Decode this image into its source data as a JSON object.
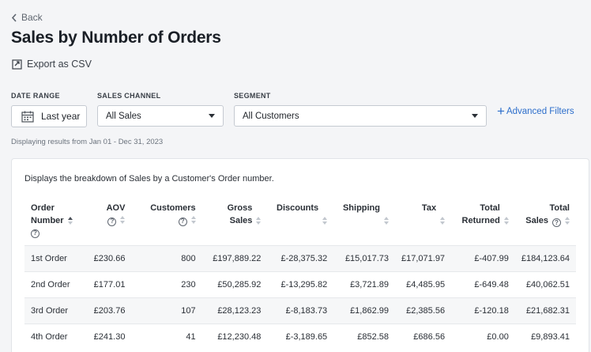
{
  "nav": {
    "back_label": "Back"
  },
  "page": {
    "title": "Sales by Number of Orders",
    "export_label": "Export as CSV"
  },
  "filters": {
    "date_range": {
      "label": "DATE RANGE",
      "value": "Last year"
    },
    "sales_channel": {
      "label": "SALES CHANNEL",
      "value": "All Sales"
    },
    "segment": {
      "label": "SEGMENT",
      "value": "All Customers"
    },
    "advanced_label": "Advanced Filters"
  },
  "range_text": "Displaying results from Jan 01 - Dec 31, 2023",
  "card": {
    "description": "Displays the breakdown of Sales by a Customer's Order number."
  },
  "table": {
    "headers": {
      "order_number": [
        "Order",
        "Number"
      ],
      "aov": "AOV",
      "customers": "Customers",
      "gross_sales": [
        "Gross",
        "Sales"
      ],
      "discounts": "Discounts",
      "shipping": "Shipping",
      "tax": "Tax",
      "total_returned": [
        "Total",
        "Returned"
      ],
      "total_sales": [
        "Total",
        "Sales"
      ]
    },
    "rows": [
      {
        "order": "1st Order",
        "aov": "£230.66",
        "customers": "800",
        "gross": "£197,889.22",
        "discounts": "£-28,375.32",
        "shipping": "£15,017.73",
        "tax": "£17,071.97",
        "returned": "£-407.99",
        "total": "£184,123.64"
      },
      {
        "order": "2nd Order",
        "aov": "£177.01",
        "customers": "230",
        "gross": "£50,285.92",
        "discounts": "£-13,295.82",
        "shipping": "£3,721.89",
        "tax": "£4,485.95",
        "returned": "£-649.48",
        "total": "£40,062.51"
      },
      {
        "order": "3rd Order",
        "aov": "£203.76",
        "customers": "107",
        "gross": "£28,123.23",
        "discounts": "£-8,183.73",
        "shipping": "£1,862.99",
        "tax": "£2,385.56",
        "returned": "£-120.18",
        "total": "£21,682.31"
      },
      {
        "order": "4th Order",
        "aov": "£241.30",
        "customers": "41",
        "gross": "£12,230.48",
        "discounts": "£-3,189.65",
        "shipping": "£852.58",
        "tax": "£686.56",
        "returned": "£0.00",
        "total": "£9,893.41"
      }
    ]
  },
  "icons": {
    "back": "chevron-left-icon",
    "export": "export-icon",
    "calendar": "calendar-icon",
    "help": "help-circle-icon",
    "sort": "sort-icon"
  },
  "colors": {
    "link": "#2c6ecb",
    "background": "#f4f5f7"
  }
}
